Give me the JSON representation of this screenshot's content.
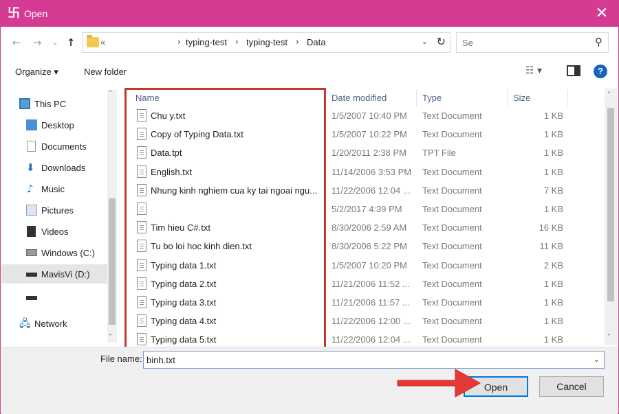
{
  "window": {
    "title": "Open",
    "app_icon_glyph": "卐",
    "close_glyph": "✕",
    "accent_color": "#d63b93"
  },
  "nav_buttons": {
    "back": "←",
    "forward": "→",
    "recent": "⌄",
    "up": "↑"
  },
  "address": {
    "overflow": "«",
    "crumbs": [
      "typing-test",
      "typing-test",
      "Data"
    ],
    "separator": "›",
    "dropdown": "⌄",
    "refresh": "↻"
  },
  "search": {
    "placeholder": "Se",
    "icon": "⚲"
  },
  "toolbar": {
    "organize": "Organize ▾",
    "new_folder": "New folder",
    "view_glyph": "☷ ▾",
    "help": "?"
  },
  "sidebar": {
    "items": [
      {
        "label": "This PC",
        "icon": "pc-icon"
      },
      {
        "label": "Desktop",
        "icon": "desktop-icon"
      },
      {
        "label": "Documents",
        "icon": "documents-icon"
      },
      {
        "label": "Downloads",
        "icon": "downloads-icon"
      },
      {
        "label": "Music",
        "icon": "music-icon"
      },
      {
        "label": "Pictures",
        "icon": "pictures-icon"
      },
      {
        "label": "Videos",
        "icon": "videos-icon"
      },
      {
        "label": "Windows (C:)",
        "icon": "drive-icon"
      },
      {
        "label": "MavisVi (D:)",
        "icon": "drive-icon"
      },
      {
        "label": "",
        "icon": "drive-icon"
      },
      {
        "label": "Network",
        "icon": "network-icon"
      }
    ],
    "glyphs": {
      "downloads": "⬇",
      "music": "♪",
      "network": "🖧",
      "chevron": "˄",
      "chevron_dn": "˅"
    }
  },
  "columns": {
    "name": "Name",
    "date": "Date modified",
    "type": "Type",
    "size": "Size"
  },
  "files": [
    {
      "name": "Chu y.txt",
      "date": "1/5/2007 10:40 PM",
      "type": "Text Document",
      "size": "1 KB"
    },
    {
      "name": "Copy of Typing Data.txt",
      "date": "1/5/2007 10:22 PM",
      "type": "Text Document",
      "size": "1 KB"
    },
    {
      "name": "Data.tpt",
      "date": "1/20/2011 2:38 PM",
      "type": "TPT File",
      "size": "1 KB"
    },
    {
      "name": "English.txt",
      "date": "11/14/2006 3:53 PM",
      "type": "Text Document",
      "size": "1 KB"
    },
    {
      "name": "Nhung kinh nghiem cua ky tai ngoai ngu...",
      "date": "11/22/2006 12:04 ...",
      "type": "Text Document",
      "size": "7 KB"
    },
    {
      "name": "",
      "date": "5/2/2017 4:39 PM",
      "type": "Text Document",
      "size": "1 KB"
    },
    {
      "name": "Tim hieu C#.txt",
      "date": "8/30/2006 2:59 AM",
      "type": "Text Document",
      "size": "16 KB"
    },
    {
      "name": "Tu bo loi hoc kinh dien.txt",
      "date": "8/30/2006 5:22 PM",
      "type": "Text Document",
      "size": "11 KB"
    },
    {
      "name": "Typing data 1.txt",
      "date": "1/5/2007 10:20 PM",
      "type": "Text Document",
      "size": "2 KB"
    },
    {
      "name": "Typing data 2.txt",
      "date": "11/21/2006 11:52 ...",
      "type": "Text Document",
      "size": "1 KB"
    },
    {
      "name": "Typing data 3.txt",
      "date": "11/21/2006 11:57 ...",
      "type": "Text Document",
      "size": "1 KB"
    },
    {
      "name": "Typing data 4.txt",
      "date": "11/22/2006 12:00 ...",
      "type": "Text Document",
      "size": "1 KB"
    },
    {
      "name": "Typing data 5.txt",
      "date": "11/22/2006 12:04 ...",
      "type": "Text Document",
      "size": "1 KB"
    }
  ],
  "file_name": {
    "label": "File name:",
    "value": "binh.txt",
    "dropdown": "⌄"
  },
  "buttons": {
    "open": "Open",
    "cancel": "Cancel"
  },
  "annotation": {
    "box_color": "#c0392b",
    "arrow_color": "#e53935"
  }
}
